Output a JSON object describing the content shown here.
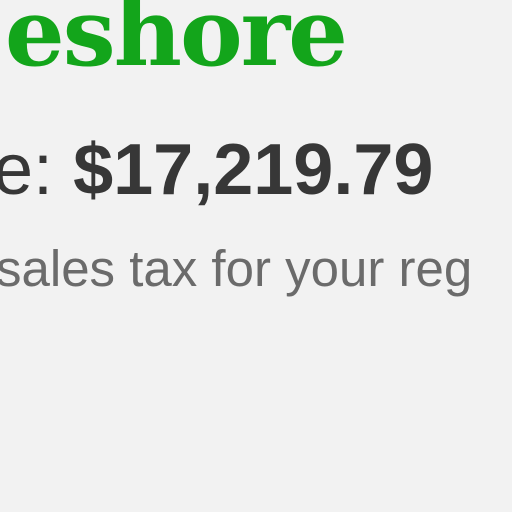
{
  "product": {
    "brand_name_fragment": "eshore",
    "price_label_fragment": "e:",
    "price_value": "$17,219.79",
    "tax_note_fragment": "sales tax for your reg"
  },
  "colors": {
    "background": "#f2f2f2",
    "brand_green": "#13a51b",
    "price_text": "#373737",
    "note_text": "#6b6b6b"
  }
}
